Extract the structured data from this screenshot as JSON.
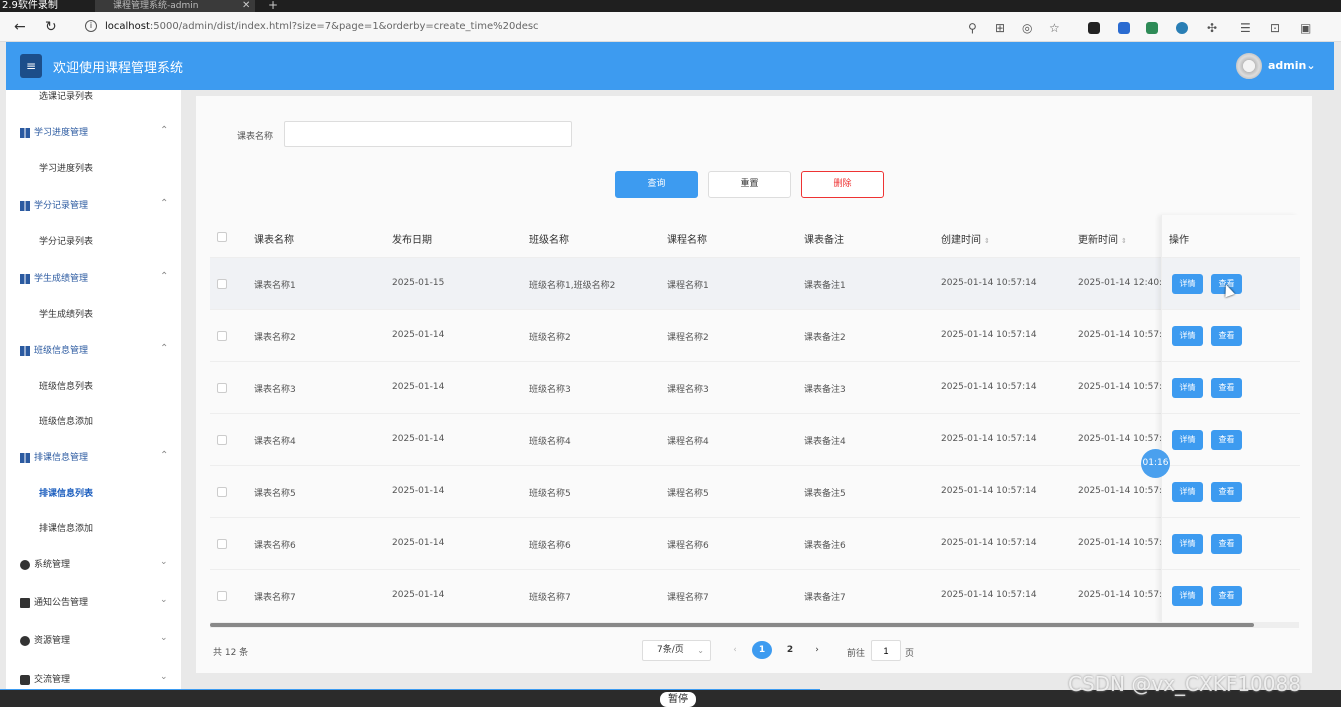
{
  "recorder": {
    "title": "2.9软件录制",
    "tab_label": "课程管理系统-admin",
    "pause_label": "暂停",
    "timer": "01:16"
  },
  "browser": {
    "url_host": "localhost",
    "url_rest": ":5000/admin/dist/index.html?size=7&page=1&orderby=create_time%20desc"
  },
  "header": {
    "title": "欢迎使用课程管理系统",
    "user": "admin"
  },
  "sidebar": {
    "groups": [
      {
        "label": "选课记录列表",
        "type": "sub-cut"
      },
      {
        "label": "学习进度管理",
        "children": [
          "学习进度列表"
        ]
      },
      {
        "label": "学分记录管理",
        "children": [
          "学分记录列表"
        ]
      },
      {
        "label": "学生成绩管理",
        "children": [
          "学生成绩列表"
        ]
      },
      {
        "label": "班级信息管理",
        "children": [
          "班级信息列表",
          "班级信息添加"
        ]
      },
      {
        "label": "排课信息管理",
        "children": [
          "排课信息列表",
          "排课信息添加"
        ]
      }
    ],
    "bottom": [
      "系统管理",
      "通知公告管理",
      "资源管理",
      "交流管理"
    ]
  },
  "filter": {
    "label": "课表名称",
    "placeholder": "",
    "query": "查询",
    "reset": "重置",
    "delete": "删除"
  },
  "table": {
    "headers": [
      "课表名称",
      "发布日期",
      "班级名称",
      "课程名称",
      "课表备注",
      "创建时间",
      "更新时间",
      "操作"
    ],
    "rows": [
      [
        "课表名称1",
        "2025-01-15",
        "班级名称1,班级名称2",
        "课程名称1",
        "课表备注1",
        "2025-01-14 10:57:14",
        "2025-01-14 12:40:"
      ],
      [
        "课表名称2",
        "2025-01-14",
        "班级名称2",
        "课程名称2",
        "课表备注2",
        "2025-01-14 10:57:14",
        "2025-01-14 10:57:"
      ],
      [
        "课表名称3",
        "2025-01-14",
        "班级名称3",
        "课程名称3",
        "课表备注3",
        "2025-01-14 10:57:14",
        "2025-01-14 10:57:"
      ],
      [
        "课表名称4",
        "2025-01-14",
        "班级名称4",
        "课程名称4",
        "课表备注4",
        "2025-01-14 10:57:14",
        "2025-01-14 10:57:"
      ],
      [
        "课表名称5",
        "2025-01-14",
        "班级名称5",
        "课程名称5",
        "课表备注5",
        "2025-01-14 10:57:14",
        "2025-01-14 10:57:"
      ],
      [
        "课表名称6",
        "2025-01-14",
        "班级名称6",
        "课程名称6",
        "课表备注6",
        "2025-01-14 10:57:14",
        "2025-01-14 10:57:"
      ],
      [
        "课表名称7",
        "2025-01-14",
        "班级名称7",
        "课程名称7",
        "课表备注7",
        "2025-01-14 10:57:14",
        "2025-01-14 10:57:"
      ]
    ],
    "action_detail": "详情",
    "action_view": "查看"
  },
  "pagination": {
    "total": "共 12 条",
    "page_size": "7条/页",
    "pages": [
      "1",
      "2"
    ],
    "goto_prefix": "前往",
    "goto_value": "1",
    "goto_suffix": "页"
  },
  "watermark": "CSDN @vx_CXKF10088",
  "colors": {
    "primary": "#3d9bf0",
    "danger": "#e33333",
    "nav_icon": "#2b5aa0"
  }
}
